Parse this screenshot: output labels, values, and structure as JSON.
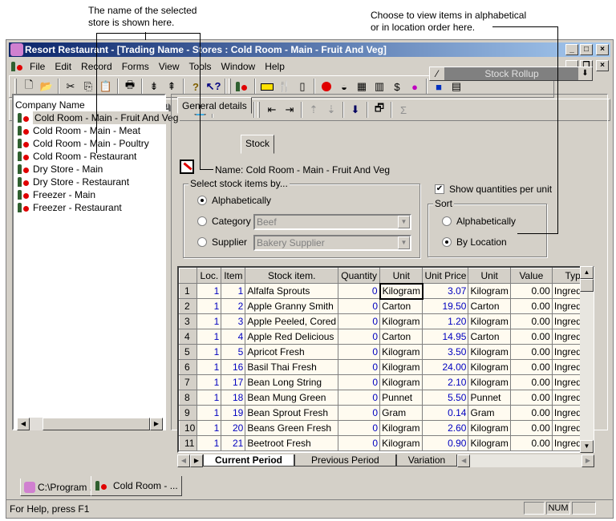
{
  "annotations": {
    "store_name_note": "The name of the selected\nstore is shown here.",
    "sort_note": "Choose to view items in alphabetical\nor in location order here."
  },
  "window": {
    "title": "Resort Restaurant - [Trading Name - Stores : Cold Room - Main - Fruit And Veg]",
    "controls": [
      "_",
      "□",
      "×"
    ],
    "mdi_controls": [
      "_",
      "❐",
      "×"
    ]
  },
  "menu": [
    {
      "label": "File",
      "key": "F"
    },
    {
      "label": "Edit",
      "key": "E"
    },
    {
      "label": "Record",
      "key": "R"
    },
    {
      "label": "Forms",
      "key": "F"
    },
    {
      "label": "View",
      "key": "V"
    },
    {
      "label": "Tools",
      "key": "T"
    },
    {
      "label": "Window",
      "key": "W"
    },
    {
      "label": "Help",
      "key": "H"
    }
  ],
  "toolbar1": [
    "new-icon",
    "open-icon",
    "cut-icon",
    "copy-icon",
    "paste-icon",
    "print-icon",
    "sort-down-icon",
    "sort-up-icon",
    "help-icon",
    "context-help-icon",
    "store-icon",
    "container-icon",
    "cutlery-icon",
    "jug-icon",
    "apple-icon",
    "bowl-icon",
    "calendar-icon",
    "book-icon",
    "price-list-icon",
    "balloons-icon",
    "truck-icon",
    "report-icon"
  ],
  "toolbar2": [
    "first-record-icon",
    "prev-record-icon",
    "next-record-icon",
    "last-record-icon",
    "new-record-icon",
    "copy-record-icon",
    "delete-record-icon",
    "save-icon",
    "save-all-icon",
    "save-close-icon",
    "filter-clear-icon",
    "filter-icon",
    "move-left-icon",
    "move-right-icon",
    "indent-icon",
    "outdent-icon",
    "import-icon",
    "window-icon",
    "sum-icon"
  ],
  "rollup_combo": {
    "value": "Stock Rollup"
  },
  "tree": {
    "root": "Company Name",
    "items": [
      "Cold Room - Main - Fruit And Veg",
      "Cold Room - Main - Meat",
      "Cold Room - Main - Poultry",
      "Cold Room - Restaurant",
      "Dry Store - Main",
      "Dry Store - Restaurant",
      "Freezer - Main",
      "Freezer - Restaurant"
    ],
    "selected_index": 0
  },
  "tabs": [
    {
      "label": "General details"
    },
    {
      "label": "Stock",
      "active": true
    }
  ],
  "stock": {
    "name_label": "Name: Cold Room - Main - Fruit And Veg",
    "select_group_title": "Select stock items by...",
    "options": [
      {
        "label": "Alphabetically",
        "selected": true
      },
      {
        "label": "Category",
        "selected": false,
        "dropdown": "Beef"
      },
      {
        "label": "Supplier",
        "selected": false,
        "dropdown": "Bakery Supplier"
      }
    ],
    "show_qty_label": "Show quantities per unit",
    "show_qty_checked": true,
    "sort_group_title": "Sort",
    "sort_options": [
      {
        "label": "Alphabetically",
        "selected": false
      },
      {
        "label": "By Location",
        "selected": true
      }
    ]
  },
  "grid": {
    "columns": [
      "Loc.",
      "Item",
      "Stock item.",
      "Quantity",
      "Unit",
      "Unit Price",
      "Unit",
      "Value",
      "Type"
    ],
    "rows": [
      [
        "1",
        "1",
        "1",
        "Alfalfa Sprouts",
        "0",
        "Kilogram",
        "3.07",
        "Kilogram",
        "0.00",
        "Ingredient"
      ],
      [
        "2",
        "1",
        "2",
        "Apple Granny Smith",
        "0",
        "Carton",
        "19.50",
        "Carton",
        "0.00",
        "Ingredient"
      ],
      [
        "3",
        "1",
        "3",
        "Apple Peeled, Cored",
        "0",
        "Kilogram",
        "1.20",
        "Kilogram",
        "0.00",
        "Ingredient"
      ],
      [
        "4",
        "1",
        "4",
        "Apple Red Delicious",
        "0",
        "Carton",
        "14.95",
        "Carton",
        "0.00",
        "Ingredient"
      ],
      [
        "5",
        "1",
        "5",
        "Apricot Fresh",
        "0",
        "Kilogram",
        "3.50",
        "Kilogram",
        "0.00",
        "Ingredient"
      ],
      [
        "6",
        "1",
        "16",
        "Basil Thai Fresh",
        "0",
        "Kilogram",
        "24.00",
        "Kilogram",
        "0.00",
        "Ingredient"
      ],
      [
        "7",
        "1",
        "17",
        "Bean Long String",
        "0",
        "Kilogram",
        "2.10",
        "Kilogram",
        "0.00",
        "Ingredient"
      ],
      [
        "8",
        "1",
        "18",
        "Bean Mung Green",
        "0",
        "Punnet",
        "5.50",
        "Punnet",
        "0.00",
        "Ingredient"
      ],
      [
        "9",
        "1",
        "19",
        "Bean Sprout Fresh",
        "0",
        "Gram",
        "0.14",
        "Gram",
        "0.00",
        "Ingredient"
      ],
      [
        "10",
        "1",
        "20",
        "Beans Green Fresh",
        "0",
        "Kilogram",
        "2.60",
        "Kilogram",
        "0.00",
        "Ingredient"
      ],
      [
        "11",
        "1",
        "21",
        "Beetroot Fresh",
        "0",
        "Kilogram",
        "0.90",
        "Kilogram",
        "0.00",
        "Ingredient"
      ]
    ]
  },
  "sheet_tabs": [
    {
      "label": "Current Period",
      "active": true
    },
    {
      "label": "Previous Period"
    },
    {
      "label": "Variation"
    }
  ],
  "doc_tabs": [
    {
      "label": "C:\\Program ..."
    },
    {
      "label": "Cold Room - ..."
    }
  ],
  "status": {
    "text": "For Help, press F1",
    "num": "NUM"
  }
}
